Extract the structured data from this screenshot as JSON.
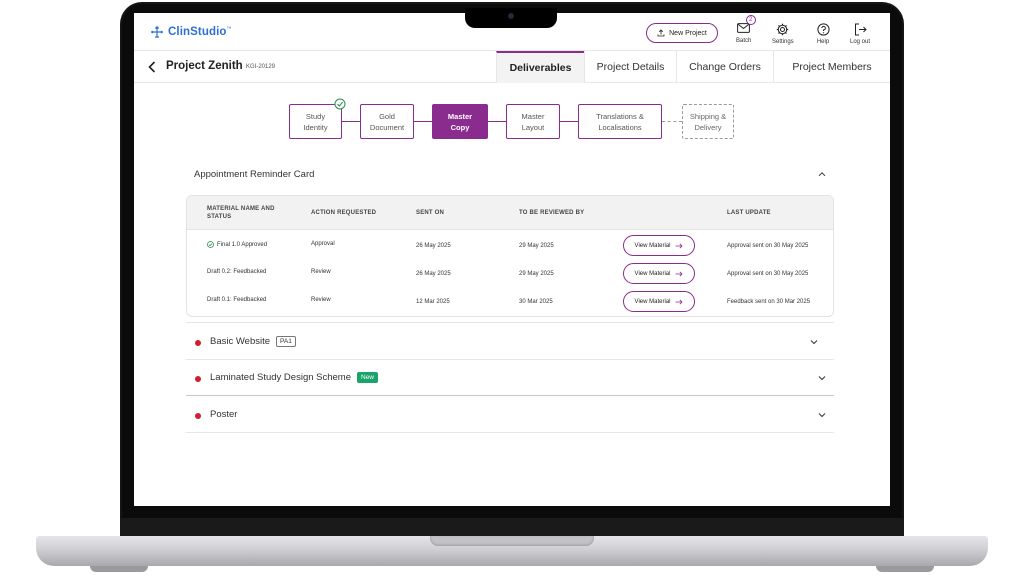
{
  "app": {
    "logo_text": "ClinStudio",
    "logo_tm": "™",
    "new_project_label": "New Project",
    "header_actions": [
      {
        "label": "Batch",
        "icon": "mail-icon",
        "badge": "2"
      },
      {
        "label": "Settings",
        "icon": "gear-icon"
      },
      {
        "label": "Help",
        "icon": "help-icon"
      },
      {
        "label": "Log out",
        "icon": "logout-icon"
      }
    ],
    "accent_color": "#8a2b8e",
    "logo_color": "#2f6fd6"
  },
  "project": {
    "title": "Project Zenith",
    "code": "KGI-20129",
    "tabs": [
      "Deliverables",
      "Project Details",
      "Change Orders",
      "Project Members"
    ],
    "active_tab": "Deliverables"
  },
  "stepper": {
    "steps": [
      {
        "line1": "Study",
        "line2": "Identity",
        "state": "complete"
      },
      {
        "line1": "Gold",
        "line2": "Document",
        "state": "complete"
      },
      {
        "line1": "Master",
        "line2": "Copy",
        "state": "active"
      },
      {
        "line1": "Master",
        "line2": "Layout",
        "state": "upcoming"
      },
      {
        "line1": "Translations &",
        "line2": "Localisations",
        "state": "upcoming"
      },
      {
        "line1": "Shipping &",
        "line2": "Delivery",
        "state": "pending"
      }
    ]
  },
  "deliverables": {
    "expanded": {
      "title": "Appointment Reminder Card",
      "columns": [
        "MATERIAL NAME AND STATUS",
        "ACTION REQUESTED",
        "SENT ON",
        "TO BE REVIEWED BY",
        "LAST UPDATE"
      ],
      "rows": [
        {
          "status": "Final 1.0 Approved",
          "approved": true,
          "action": "Approval",
          "sent_on": "26 May 2025",
          "review_by": "29 May 2025",
          "button": "View Material",
          "last_update": "Approval sent on 30 May 2025"
        },
        {
          "status": "Draft 0.2: Feedbacked",
          "approved": false,
          "action": "Review",
          "sent_on": "26 May 2025",
          "review_by": "29 May 2025",
          "button": "View Material",
          "last_update": "Approval sent on 30 May 2025"
        },
        {
          "status": "Draft 0.1: Feedbacked",
          "approved": false,
          "action": "Review",
          "sent_on": "12 Mar 2025",
          "review_by": "30 Mar 2025",
          "button": "View Material",
          "last_update": "Feedback sent on 30 Mar 2025"
        }
      ]
    },
    "collapsed": [
      {
        "title": "Basic Website",
        "tag": "PA1",
        "tag_type": "outline"
      },
      {
        "title": "Laminated Study Design Scheme",
        "tag": "New",
        "tag_type": "new"
      },
      {
        "title": "Poster",
        "tag": "",
        "tag_type": ""
      }
    ]
  }
}
